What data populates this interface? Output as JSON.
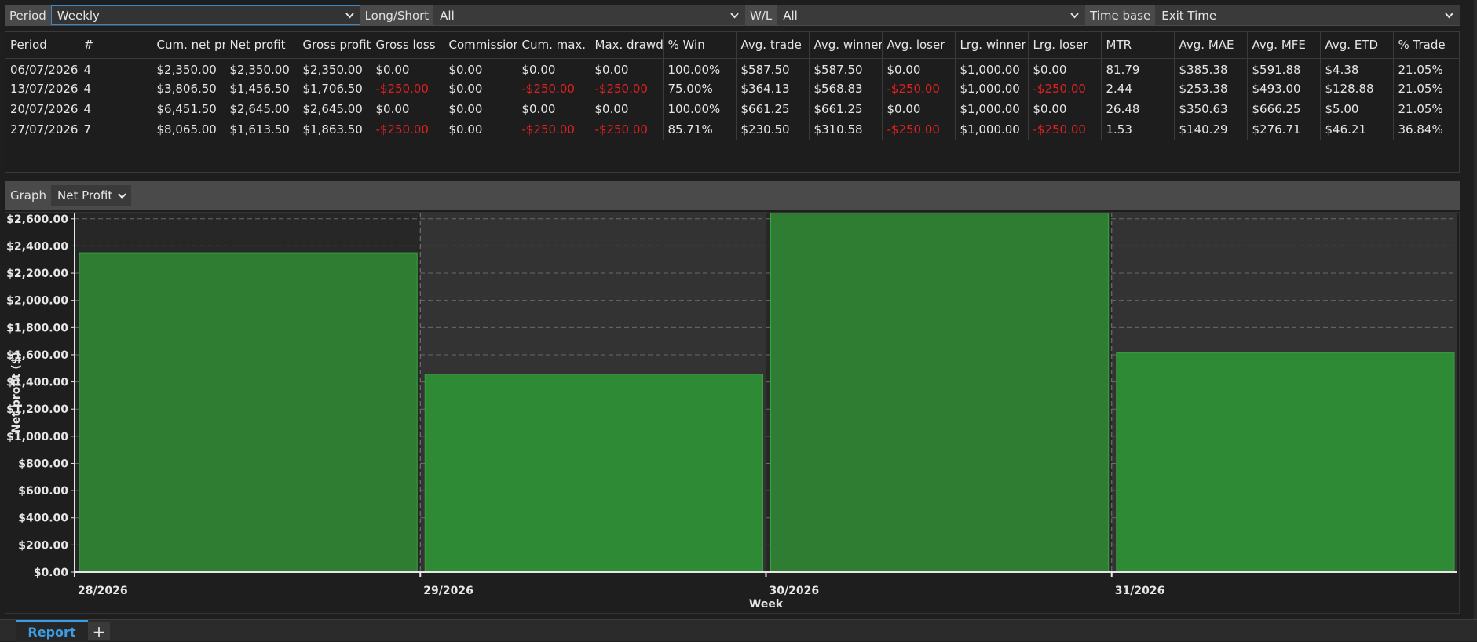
{
  "filters": {
    "period_label": "Period",
    "period_value": "Weekly",
    "longshort_label": "Long/Short",
    "longshort_value": "All",
    "wl_label": "W/L",
    "wl_value": "All",
    "timebase_label": "Time base",
    "timebase_value": "Exit Time"
  },
  "table": {
    "headers": [
      "Period",
      "#",
      "Cum. net pr",
      "Net profit",
      "Gross profit",
      "Gross loss",
      "Commissior",
      "Cum. max. d",
      "Max. drawdo",
      "% Win",
      "Avg. trade",
      "Avg. winner",
      "Avg. loser",
      "Lrg. winner",
      "Lrg. loser",
      "MTR",
      "Avg. MAE",
      "Avg. MFE",
      "Avg. ETD",
      "% Trade"
    ],
    "rows": [
      [
        "06/07/2026",
        "4",
        "$2,350.00",
        "$2,350.00",
        "$2,350.00",
        "$0.00",
        "$0.00",
        "$0.00",
        "$0.00",
        "100.00%",
        "$587.50",
        "$587.50",
        "$0.00",
        "$1,000.00",
        "$0.00",
        "81.79",
        "$385.38",
        "$591.88",
        "$4.38",
        "21.05%"
      ],
      [
        "13/07/2026",
        "4",
        "$3,806.50",
        "$1,456.50",
        "$1,706.50",
        "-$250.00",
        "$0.00",
        "-$250.00",
        "-$250.00",
        "75.00%",
        "$364.13",
        "$568.83",
        "-$250.00",
        "$1,000.00",
        "-$250.00",
        "2.44",
        "$253.38",
        "$493.00",
        "$128.88",
        "21.05%"
      ],
      [
        "20/07/2026",
        "4",
        "$6,451.50",
        "$2,645.00",
        "$2,645.00",
        "$0.00",
        "$0.00",
        "$0.00",
        "$0.00",
        "100.00%",
        "$661.25",
        "$661.25",
        "$0.00",
        "$1,000.00",
        "$0.00",
        "26.48",
        "$350.63",
        "$666.25",
        "$5.00",
        "21.05%"
      ],
      [
        "27/07/2026",
        "7",
        "$8,065.00",
        "$1,613.50",
        "$1,863.50",
        "-$250.00",
        "$0.00",
        "-$250.00",
        "-$250.00",
        "85.71%",
        "$230.50",
        "$310.58",
        "-$250.00",
        "$1,000.00",
        "-$250.00",
        "1.53",
        "$140.29",
        "$276.71",
        "$46.21",
        "36.84%"
      ]
    ]
  },
  "graph": {
    "label": "Graph",
    "selected": "Net Profit"
  },
  "chart_data": {
    "type": "bar",
    "categories": [
      "28/2026",
      "29/2026",
      "30/2026",
      "31/2026"
    ],
    "values": [
      2350.0,
      1456.5,
      2645.0,
      1613.5
    ],
    "xlabel": "Week",
    "ylabel": "Net profit ($)",
    "ylim": [
      0,
      2645
    ],
    "yticks": [
      0,
      200,
      400,
      600,
      800,
      1000,
      1200,
      1400,
      1600,
      1800,
      2000,
      2200,
      2400,
      2600
    ],
    "ytick_labels": [
      "$0.00",
      "$200.00",
      "$400.00",
      "$600.00",
      "$800.00",
      "$1,000.00",
      "$1,200.00",
      "$1,400.00",
      "$1,600.00",
      "$1,800.00",
      "$2,000.00",
      "$2,200.00",
      "$2,400.00",
      "$2,600.00"
    ],
    "grid": true,
    "bar_color": "#2e7d32",
    "alt_band_color": "#333333"
  },
  "tabs": {
    "active": "Report",
    "add_label": "+"
  },
  "colors": {
    "negative": "#e02020",
    "accent": "#3d9ce6"
  }
}
